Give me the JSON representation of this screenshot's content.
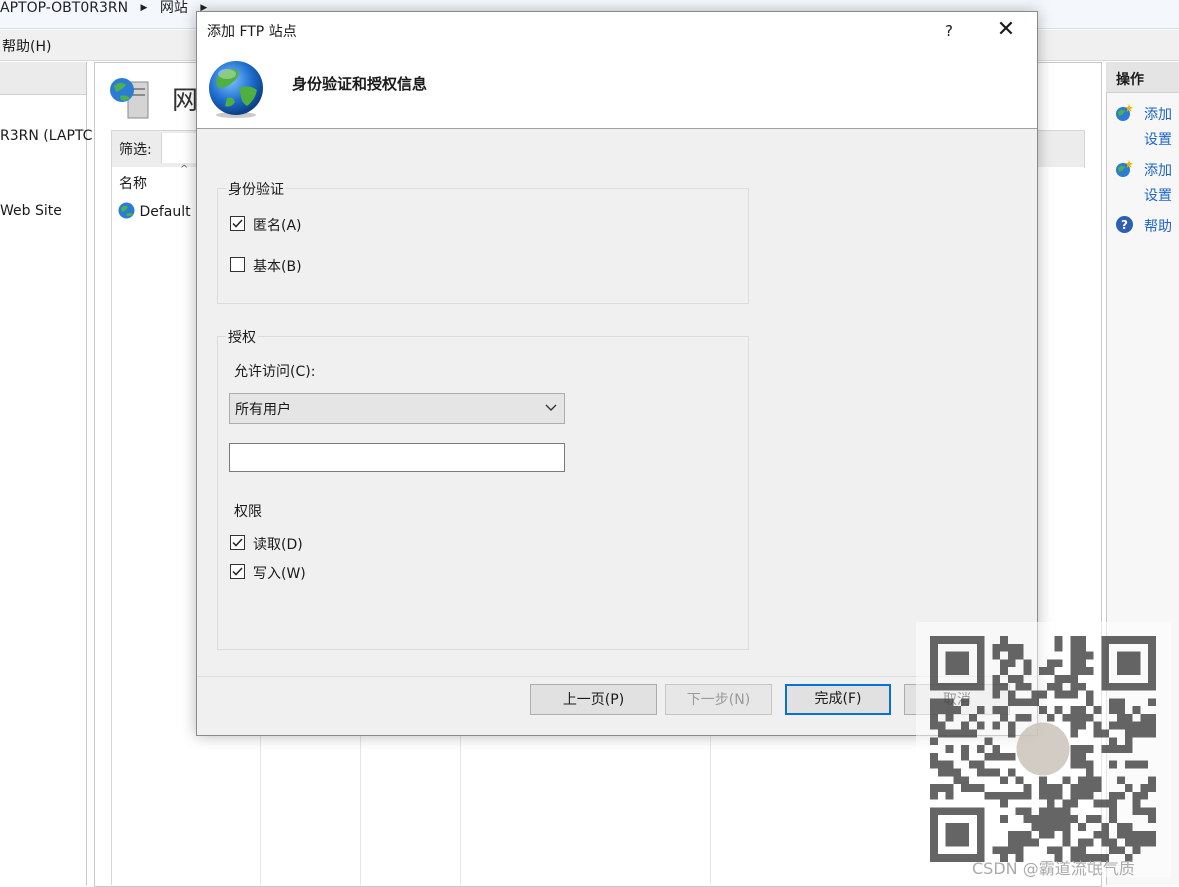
{
  "address_bar": {
    "machine": "APTOP-OBT0R3RN",
    "section": "网站"
  },
  "menu": {
    "help": "帮助(H)"
  },
  "tree": {
    "server": "R3RN (LAPTC",
    "site": "Web Site"
  },
  "center": {
    "title": "网",
    "filter_label": "筛选:",
    "column_name": "名称",
    "row_default": "Default '"
  },
  "actions": {
    "title": "操作",
    "items": [
      {
        "line1": "添加",
        "line2": "设置"
      },
      {
        "line1": "添加",
        "line2": "设置"
      },
      {
        "line1": "帮助"
      }
    ]
  },
  "dialog": {
    "title": "添加 FTP 站点",
    "help_glyph": "?",
    "close_glyph": "✕",
    "heading": "身份验证和授权信息",
    "auth_group": {
      "legend": "身份验证",
      "anonymous": {
        "label": "匿名(A)",
        "checked": true
      },
      "basic": {
        "label": "基本(B)",
        "checked": false
      }
    },
    "authz_group": {
      "legend": "授权",
      "allow_label": "允许访问(C):",
      "allow_value": "所有用户",
      "allow_text_value": "",
      "permissions_label": "权限",
      "read": {
        "label": "读取(D)",
        "checked": true
      },
      "write": {
        "label": "写入(W)",
        "checked": true
      }
    },
    "buttons": {
      "prev": "上一页(P)",
      "next": "下一步(N)",
      "finish": "完成(F)",
      "cancel": "取消"
    }
  },
  "watermark": "CSDN @霸道流氓气质",
  "colors": {
    "link": "#1e65c8",
    "default_button_border": "#0a6fd6",
    "dialog_bg": "#f0f0f0"
  }
}
